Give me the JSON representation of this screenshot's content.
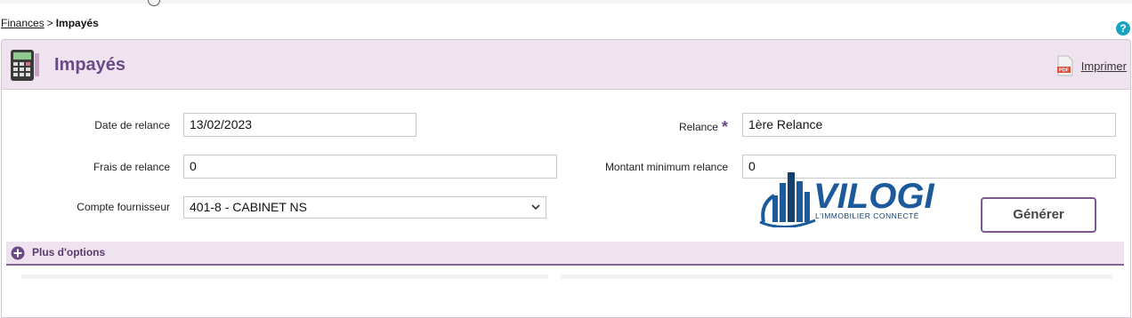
{
  "breadcrumb": {
    "parent": "Finances",
    "separator": ">",
    "current": "Impayés"
  },
  "help": {
    "symbol": "?"
  },
  "header": {
    "title": "Impayés",
    "print_label": "Imprimer",
    "pdf_badge": "PDF"
  },
  "form": {
    "date_relance": {
      "label": "Date de relance",
      "value": "13/02/2023"
    },
    "relance": {
      "label": "Relance",
      "required_mark": "*",
      "value": "1ère Relance"
    },
    "frais_relance": {
      "label": "Frais de relance",
      "value": "0"
    },
    "montant_min": {
      "label": "Montant minimum relance",
      "value": "0"
    },
    "compte_fournisseur": {
      "label": "Compte fournisseur",
      "value": "401-8 - CABINET NS"
    }
  },
  "logo": {
    "name": "VILOGI",
    "tagline": "L'IMMOBILIER CONNECTÉ"
  },
  "actions": {
    "generate_label": "Générer"
  },
  "options": {
    "label": "Plus d'options"
  },
  "colors": {
    "accent": "#6a4a86",
    "header_bg": "#efe3f0",
    "help": "#1aa3c3",
    "logo_blue": "#1d5a9b"
  }
}
